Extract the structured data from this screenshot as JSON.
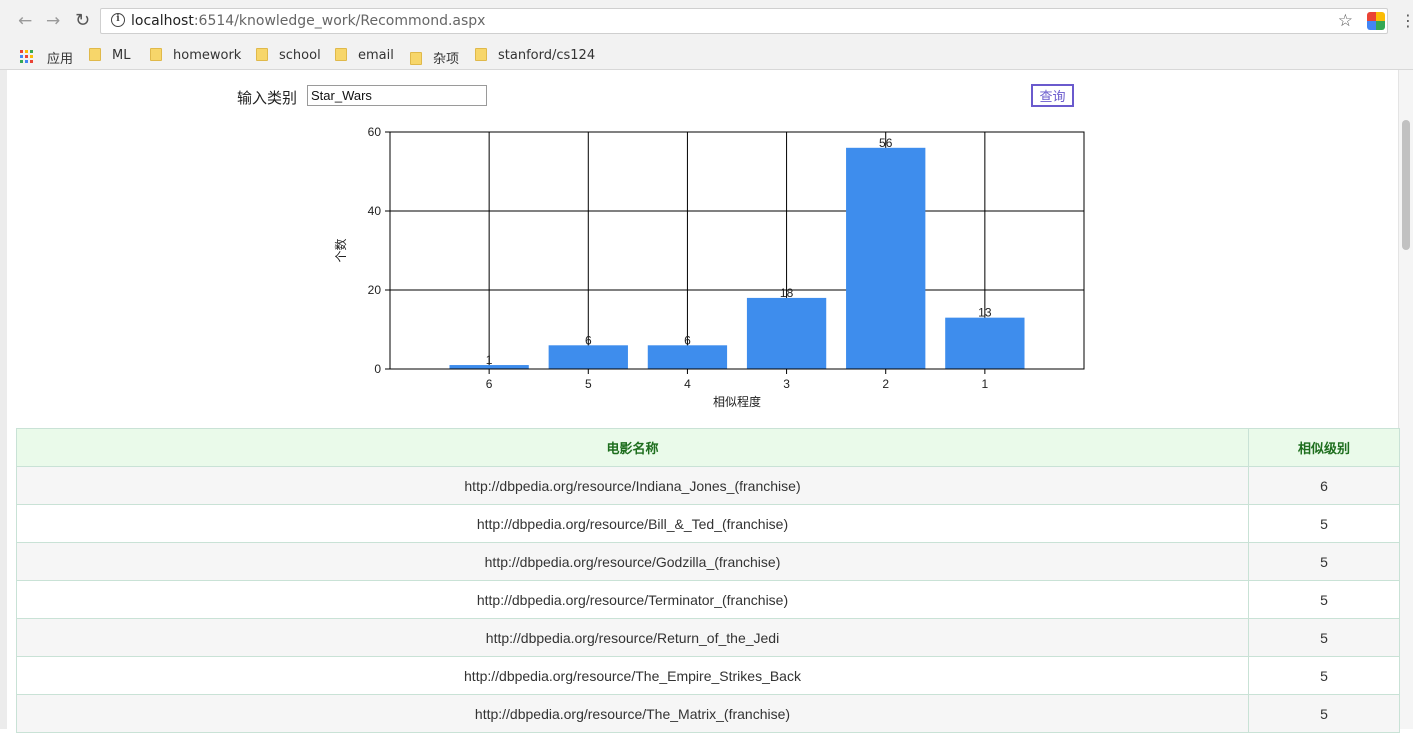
{
  "browser": {
    "url_host": "localhost",
    "url_rest": ":6514/knowledge_work/Recommond.aspx",
    "bookmarks": [
      {
        "label": "应用",
        "kind": "apps"
      },
      {
        "label": "ML",
        "kind": "folder"
      },
      {
        "label": "homework",
        "kind": "folder"
      },
      {
        "label": "school",
        "kind": "folder"
      },
      {
        "label": "email",
        "kind": "folder"
      },
      {
        "label": "杂项",
        "kind": "folder"
      },
      {
        "label": "stanford/cs124",
        "kind": "folder"
      }
    ]
  },
  "query": {
    "label": "输入类别",
    "value": "Star_Wars",
    "button_label": "查询"
  },
  "chart_data": {
    "type": "bar",
    "categories": [
      "6",
      "5",
      "4",
      "3",
      "2",
      "1"
    ],
    "values": [
      1,
      6,
      6,
      18,
      56,
      13
    ],
    "data_labels": [
      "1",
      "6",
      "6",
      "18",
      "56",
      "13"
    ],
    "xlabel": "相似程度",
    "ylabel": "个数",
    "ylim": [
      0,
      60
    ],
    "yticks": [
      0,
      20,
      40,
      60
    ],
    "grid": true,
    "bar_color": "#3e8ded"
  },
  "table": {
    "headers": [
      "电影名称",
      "相似级别"
    ],
    "rows": [
      [
        "http://dbpedia.org/resource/Indiana_Jones_(franchise)",
        "6"
      ],
      [
        "http://dbpedia.org/resource/Bill_&_Ted_(franchise)",
        "5"
      ],
      [
        "http://dbpedia.org/resource/Godzilla_(franchise)",
        "5"
      ],
      [
        "http://dbpedia.org/resource/Terminator_(franchise)",
        "5"
      ],
      [
        "http://dbpedia.org/resource/Return_of_the_Jedi",
        "5"
      ],
      [
        "http://dbpedia.org/resource/The_Empire_Strikes_Back",
        "5"
      ],
      [
        "http://dbpedia.org/resource/The_Matrix_(franchise)",
        "5"
      ]
    ]
  }
}
